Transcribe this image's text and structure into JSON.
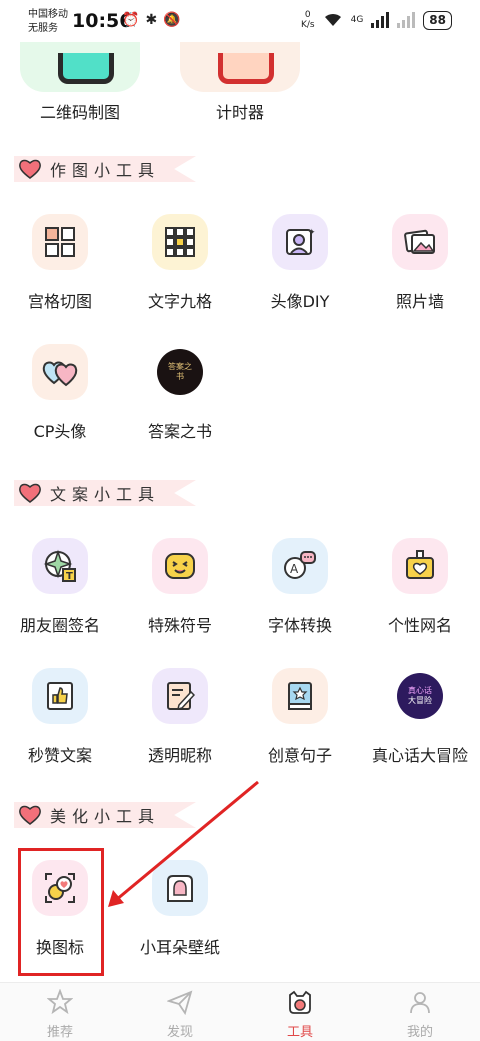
{
  "status_bar": {
    "carrier_1": "中国移动",
    "carrier_2": "无服务",
    "time": "10:56",
    "speed_value": "0",
    "speed_unit": "K/s",
    "network": "4G",
    "battery": "88"
  },
  "top_items": [
    {
      "label": "二维码制图"
    },
    {
      "label": "计时器"
    }
  ],
  "sections": [
    {
      "title": "作图小工具",
      "items": [
        {
          "label": "宫格切图",
          "icon": "grid-split-icon"
        },
        {
          "label": "文字九格",
          "icon": "text-nine-grid-icon"
        },
        {
          "label": "头像DIY",
          "icon": "avatar-diy-icon"
        },
        {
          "label": "照片墙",
          "icon": "photo-wall-icon"
        },
        {
          "label": "CP头像",
          "icon": "couple-hearts-icon"
        },
        {
          "label": "答案之书",
          "icon": "answer-book-icon",
          "badge_text": "答案之书"
        }
      ]
    },
    {
      "title": "文案小工具",
      "items": [
        {
          "label": "朋友圈签名",
          "icon": "aperture-text-icon"
        },
        {
          "label": "特殊符号",
          "icon": "emoji-face-icon"
        },
        {
          "label": "字体转换",
          "icon": "font-chat-icon"
        },
        {
          "label": "个性网名",
          "icon": "name-badge-icon"
        },
        {
          "label": "秒赞文案",
          "icon": "thumbs-up-icon"
        },
        {
          "label": "透明昵称",
          "icon": "note-edit-icon"
        },
        {
          "label": "创意句子",
          "icon": "book-star-icon"
        },
        {
          "label": "真心话大冒险",
          "icon": "truth-dare-icon",
          "badge_line1": "真心话",
          "badge_line2": "大冒险"
        }
      ]
    },
    {
      "title": "美化小工具",
      "items": [
        {
          "label": "换图标",
          "icon": "swap-icon-icon"
        },
        {
          "label": "小耳朵壁纸",
          "icon": "ear-wallpaper-icon"
        }
      ]
    }
  ],
  "bottom_nav": [
    {
      "label": "推荐",
      "icon": "star-icon",
      "active": false
    },
    {
      "label": "发现",
      "icon": "paper-plane-icon",
      "active": false
    },
    {
      "label": "工具",
      "icon": "tools-cat-icon",
      "active": true
    },
    {
      "label": "我的",
      "icon": "profile-icon",
      "active": false
    }
  ],
  "colors": {
    "accent": "#e04848",
    "highlight": "#e02424",
    "ribbon": "#fdeaea"
  }
}
